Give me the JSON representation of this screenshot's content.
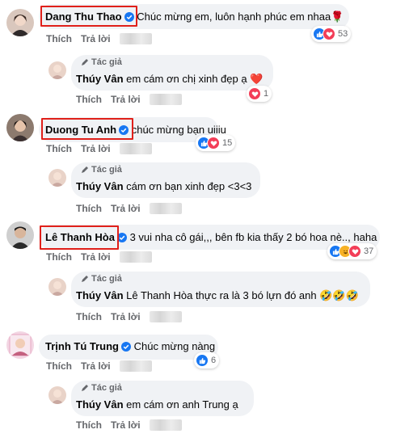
{
  "comments": [
    {
      "name": "Dang Thu Thao",
      "text": "Chúc mừng em, luôn hạnh phúc em nhaa🌹",
      "like_label": "Thích",
      "reply_label": "Trả lời",
      "reaction_count": "53",
      "reply": {
        "author_tag": "Tác giả",
        "name": "Thúy Vân",
        "text": "em cám ơn chị xinh đẹp ạ ❤️",
        "like_label": "Thích",
        "reply_label": "Trả lời",
        "reaction_count": "1"
      }
    },
    {
      "name": "Duong Tu Anh",
      "text": "chúc mừng bạn uiiiu",
      "like_label": "Thích",
      "reply_label": "Trả lời",
      "reaction_count": "15",
      "reply": {
        "author_tag": "Tác giả",
        "name": "Thúy Vân",
        "text": "cám ơn bạn xinh đẹp <3<3",
        "like_label": "Thích",
        "reply_label": "Trả lời"
      }
    },
    {
      "name": "Lê Thanh Hòa",
      "text": "3 vui nha cô gái,,, bên fb kia thấy 2 bó hoa nè.., haha",
      "like_label": "Thích",
      "reply_label": "Trả lời",
      "reaction_count": "37",
      "reply": {
        "author_tag": "Tác giả",
        "name": "Thúy Vân",
        "mention": "Lê Thanh Hòa",
        "text": "thực ra là 3 bó lựn đó anh 🤣🤣🤣",
        "like_label": "Thích",
        "reply_label": "Trả lời"
      }
    },
    {
      "name": "Trịnh Tú Trung",
      "text": "Chúc mừng nàng",
      "like_label": "Thích",
      "reply_label": "Trả lời",
      "reaction_count": "6",
      "reply": {
        "author_tag": "Tác giả",
        "name": "Thúy Vân",
        "text": "em cám ơn anh Trung ạ",
        "like_label": "Thích",
        "reply_label": "Trả lời"
      }
    }
  ],
  "colors": {
    "bubble": "#f0f2f5",
    "highlight_box": "#e0201a",
    "like_blue": "#1877f2",
    "love_red": "#f33e58",
    "haha_yellow": "#f7b125",
    "secondary_text": "#65676b"
  },
  "icons": {
    "verified": "verified-badge-icon",
    "author": "pen-icon",
    "reactions": [
      "like-icon",
      "love-icon",
      "haha-icon"
    ]
  }
}
